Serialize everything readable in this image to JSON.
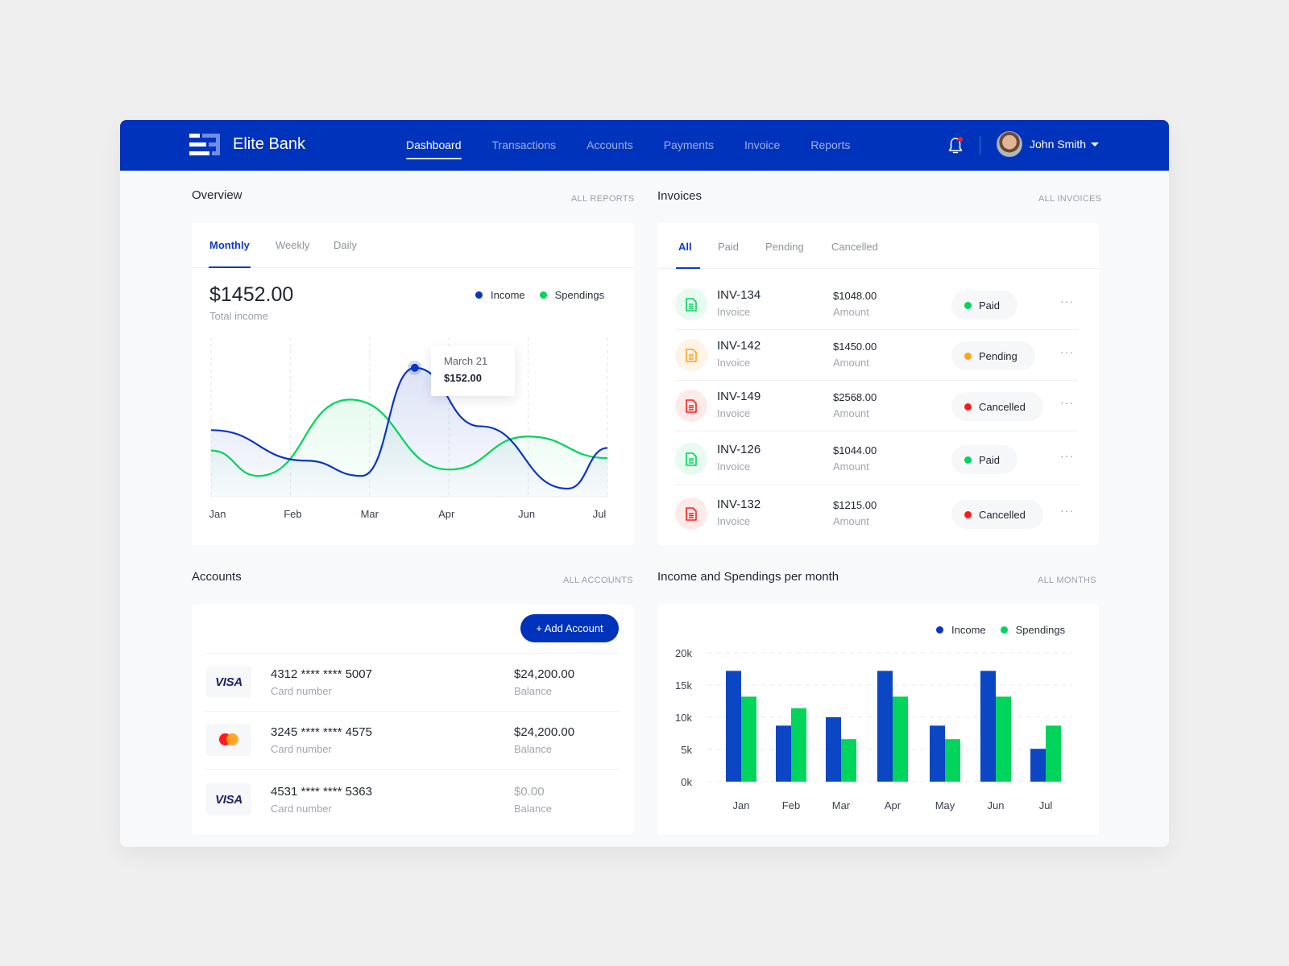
{
  "app": {
    "brand": "Elite Bank",
    "nav": [
      "Dashboard",
      "Transactions",
      "Accounts",
      "Payments",
      "Invoice",
      "Reports"
    ],
    "active_nav": "Dashboard",
    "user_name": "John Smith",
    "notification_unread": true
  },
  "colors": {
    "primary": "#0033bb",
    "income": "#0a35c2",
    "spendings": "#00d45a",
    "paid": "#00d45a",
    "pending": "#ffa41b",
    "cancelled": "#ff1a1a"
  },
  "overview": {
    "title": "Overview",
    "link": "ALL REPORTS",
    "tabs": [
      "Monthly",
      "Weekly",
      "Daily"
    ],
    "active_tab": "Monthly",
    "amount": "$1452.00",
    "amount_label": "Total income",
    "legend": [
      "Income",
      "Spendings"
    ],
    "tooltip": {
      "date": "March 21",
      "value": "$152.00"
    }
  },
  "invoices": {
    "title": "Invoices",
    "link": "ALL INVOICES",
    "tabs": [
      "All",
      "Paid",
      "Pending",
      "Cancelled"
    ],
    "active_tab": "All",
    "rows": [
      {
        "id": "INV-134",
        "id_label": "Invoice",
        "amount": "$1048.00",
        "amount_label": "Amount",
        "status": "Paid",
        "status_key": "paid"
      },
      {
        "id": "INV-142",
        "id_label": "Invoice",
        "amount": "$1450.00",
        "amount_label": "Amount",
        "status": "Pending",
        "status_key": "pending"
      },
      {
        "id": "INV-149",
        "id_label": "Invoice",
        "amount": "$2568.00",
        "amount_label": "Amount",
        "status": "Cancelled",
        "status_key": "cancelled"
      },
      {
        "id": "INV-126",
        "id_label": "Invoice",
        "amount": "$1044.00",
        "amount_label": "Amount",
        "status": "Paid",
        "status_key": "paid"
      },
      {
        "id": "INV-132",
        "id_label": "Invoice",
        "amount": "$1215.00",
        "amount_label": "Amount",
        "status": "Cancelled",
        "status_key": "cancelled"
      }
    ],
    "more_label": "···"
  },
  "accounts": {
    "title": "Accounts",
    "link": "ALL ACCOUNTS",
    "add_button": "+ Add Account",
    "rows": [
      {
        "brand": "visa",
        "number": "4312 **** **** 5007",
        "number_label": "Card number",
        "balance": "$24,200.00",
        "balance_label": "Balance",
        "muted": false
      },
      {
        "brand": "mastercard",
        "number": "3245 **** **** 4575",
        "number_label": "Card number",
        "balance": "$24,200.00",
        "balance_label": "Balance",
        "muted": false
      },
      {
        "brand": "visa",
        "number": "4531 **** **** 5363",
        "number_label": "Card number",
        "balance": "$0.00",
        "balance_label": "Balance",
        "muted": true
      }
    ],
    "visa_text": "VISA"
  },
  "monthly": {
    "title": "Income and Spendings per month",
    "link": "ALL MONTHS",
    "legend": [
      "Income",
      "Spendings"
    ]
  },
  "chart_data": [
    {
      "type": "line",
      "title": "Overview",
      "x": [
        "Jan",
        "Feb",
        "Mar",
        "Apr",
        "Jun",
        "Jul"
      ],
      "series": [
        {
          "name": "Income",
          "values": [
            0.46,
            0.22,
            0.1,
            0.95,
            0.49,
            0.0,
            0.32
          ],
          "x_pos": [
            0,
            1.2,
            1.9,
            2.57,
            3.4,
            4.5,
            5.0
          ]
        },
        {
          "name": "Spendings",
          "values": [
            0.3,
            0.1,
            0.7,
            0.15,
            0.41,
            0.24
          ],
          "x_pos": [
            0,
            0.6,
            1.75,
            3.0,
            4.0,
            5.0
          ]
        }
      ],
      "tooltip": {
        "label": "March 21",
        "value": "$152.00"
      },
      "ylabel": "",
      "xlabel": "",
      "grid": "vertical-dashed",
      "legend": "top-right"
    },
    {
      "type": "bar",
      "title": "Income and Spendings per month",
      "categories": [
        "Jan",
        "Feb",
        "Mar",
        "Apr",
        "May",
        "Jun",
        "Jul"
      ],
      "series": [
        {
          "name": "Income",
          "values": [
            17200,
            8700,
            10000,
            17200,
            8700,
            17200,
            5100
          ]
        },
        {
          "name": "Spendings",
          "values": [
            13200,
            11400,
            6600,
            13200,
            6600,
            13200,
            8700
          ]
        }
      ],
      "yticks": [
        "0k",
        "5k",
        "10k",
        "15k",
        "20k"
      ],
      "ylim": [
        0,
        20000
      ],
      "xlabel": "",
      "ylabel": "",
      "grid": "horizontal-dashed",
      "legend": "top-right"
    }
  ]
}
